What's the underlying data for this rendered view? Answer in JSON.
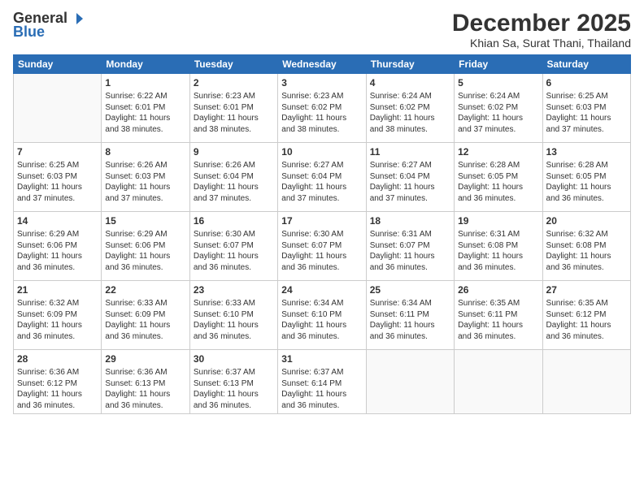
{
  "logo": {
    "line1": "General",
    "line2": "Blue"
  },
  "title": "December 2025",
  "location": "Khian Sa, Surat Thani, Thailand",
  "header_days": [
    "Sunday",
    "Monday",
    "Tuesday",
    "Wednesday",
    "Thursday",
    "Friday",
    "Saturday"
  ],
  "weeks": [
    [
      {
        "day": "",
        "info": ""
      },
      {
        "day": "1",
        "info": "Sunrise: 6:22 AM\nSunset: 6:01 PM\nDaylight: 11 hours\nand 38 minutes."
      },
      {
        "day": "2",
        "info": "Sunrise: 6:23 AM\nSunset: 6:01 PM\nDaylight: 11 hours\nand 38 minutes."
      },
      {
        "day": "3",
        "info": "Sunrise: 6:23 AM\nSunset: 6:02 PM\nDaylight: 11 hours\nand 38 minutes."
      },
      {
        "day": "4",
        "info": "Sunrise: 6:24 AM\nSunset: 6:02 PM\nDaylight: 11 hours\nand 38 minutes."
      },
      {
        "day": "5",
        "info": "Sunrise: 6:24 AM\nSunset: 6:02 PM\nDaylight: 11 hours\nand 37 minutes."
      },
      {
        "day": "6",
        "info": "Sunrise: 6:25 AM\nSunset: 6:03 PM\nDaylight: 11 hours\nand 37 minutes."
      }
    ],
    [
      {
        "day": "7",
        "info": "Sunrise: 6:25 AM\nSunset: 6:03 PM\nDaylight: 11 hours\nand 37 minutes."
      },
      {
        "day": "8",
        "info": "Sunrise: 6:26 AM\nSunset: 6:03 PM\nDaylight: 11 hours\nand 37 minutes."
      },
      {
        "day": "9",
        "info": "Sunrise: 6:26 AM\nSunset: 6:04 PM\nDaylight: 11 hours\nand 37 minutes."
      },
      {
        "day": "10",
        "info": "Sunrise: 6:27 AM\nSunset: 6:04 PM\nDaylight: 11 hours\nand 37 minutes."
      },
      {
        "day": "11",
        "info": "Sunrise: 6:27 AM\nSunset: 6:04 PM\nDaylight: 11 hours\nand 37 minutes."
      },
      {
        "day": "12",
        "info": "Sunrise: 6:28 AM\nSunset: 6:05 PM\nDaylight: 11 hours\nand 36 minutes."
      },
      {
        "day": "13",
        "info": "Sunrise: 6:28 AM\nSunset: 6:05 PM\nDaylight: 11 hours\nand 36 minutes."
      }
    ],
    [
      {
        "day": "14",
        "info": "Sunrise: 6:29 AM\nSunset: 6:06 PM\nDaylight: 11 hours\nand 36 minutes."
      },
      {
        "day": "15",
        "info": "Sunrise: 6:29 AM\nSunset: 6:06 PM\nDaylight: 11 hours\nand 36 minutes."
      },
      {
        "day": "16",
        "info": "Sunrise: 6:30 AM\nSunset: 6:07 PM\nDaylight: 11 hours\nand 36 minutes."
      },
      {
        "day": "17",
        "info": "Sunrise: 6:30 AM\nSunset: 6:07 PM\nDaylight: 11 hours\nand 36 minutes."
      },
      {
        "day": "18",
        "info": "Sunrise: 6:31 AM\nSunset: 6:07 PM\nDaylight: 11 hours\nand 36 minutes."
      },
      {
        "day": "19",
        "info": "Sunrise: 6:31 AM\nSunset: 6:08 PM\nDaylight: 11 hours\nand 36 minutes."
      },
      {
        "day": "20",
        "info": "Sunrise: 6:32 AM\nSunset: 6:08 PM\nDaylight: 11 hours\nand 36 minutes."
      }
    ],
    [
      {
        "day": "21",
        "info": "Sunrise: 6:32 AM\nSunset: 6:09 PM\nDaylight: 11 hours\nand 36 minutes."
      },
      {
        "day": "22",
        "info": "Sunrise: 6:33 AM\nSunset: 6:09 PM\nDaylight: 11 hours\nand 36 minutes."
      },
      {
        "day": "23",
        "info": "Sunrise: 6:33 AM\nSunset: 6:10 PM\nDaylight: 11 hours\nand 36 minutes."
      },
      {
        "day": "24",
        "info": "Sunrise: 6:34 AM\nSunset: 6:10 PM\nDaylight: 11 hours\nand 36 minutes."
      },
      {
        "day": "25",
        "info": "Sunrise: 6:34 AM\nSunset: 6:11 PM\nDaylight: 11 hours\nand 36 minutes."
      },
      {
        "day": "26",
        "info": "Sunrise: 6:35 AM\nSunset: 6:11 PM\nDaylight: 11 hours\nand 36 minutes."
      },
      {
        "day": "27",
        "info": "Sunrise: 6:35 AM\nSunset: 6:12 PM\nDaylight: 11 hours\nand 36 minutes."
      }
    ],
    [
      {
        "day": "28",
        "info": "Sunrise: 6:36 AM\nSunset: 6:12 PM\nDaylight: 11 hours\nand 36 minutes."
      },
      {
        "day": "29",
        "info": "Sunrise: 6:36 AM\nSunset: 6:13 PM\nDaylight: 11 hours\nand 36 minutes."
      },
      {
        "day": "30",
        "info": "Sunrise: 6:37 AM\nSunset: 6:13 PM\nDaylight: 11 hours\nand 36 minutes."
      },
      {
        "day": "31",
        "info": "Sunrise: 6:37 AM\nSunset: 6:14 PM\nDaylight: 11 hours\nand 36 minutes."
      },
      {
        "day": "",
        "info": ""
      },
      {
        "day": "",
        "info": ""
      },
      {
        "day": "",
        "info": ""
      }
    ]
  ]
}
